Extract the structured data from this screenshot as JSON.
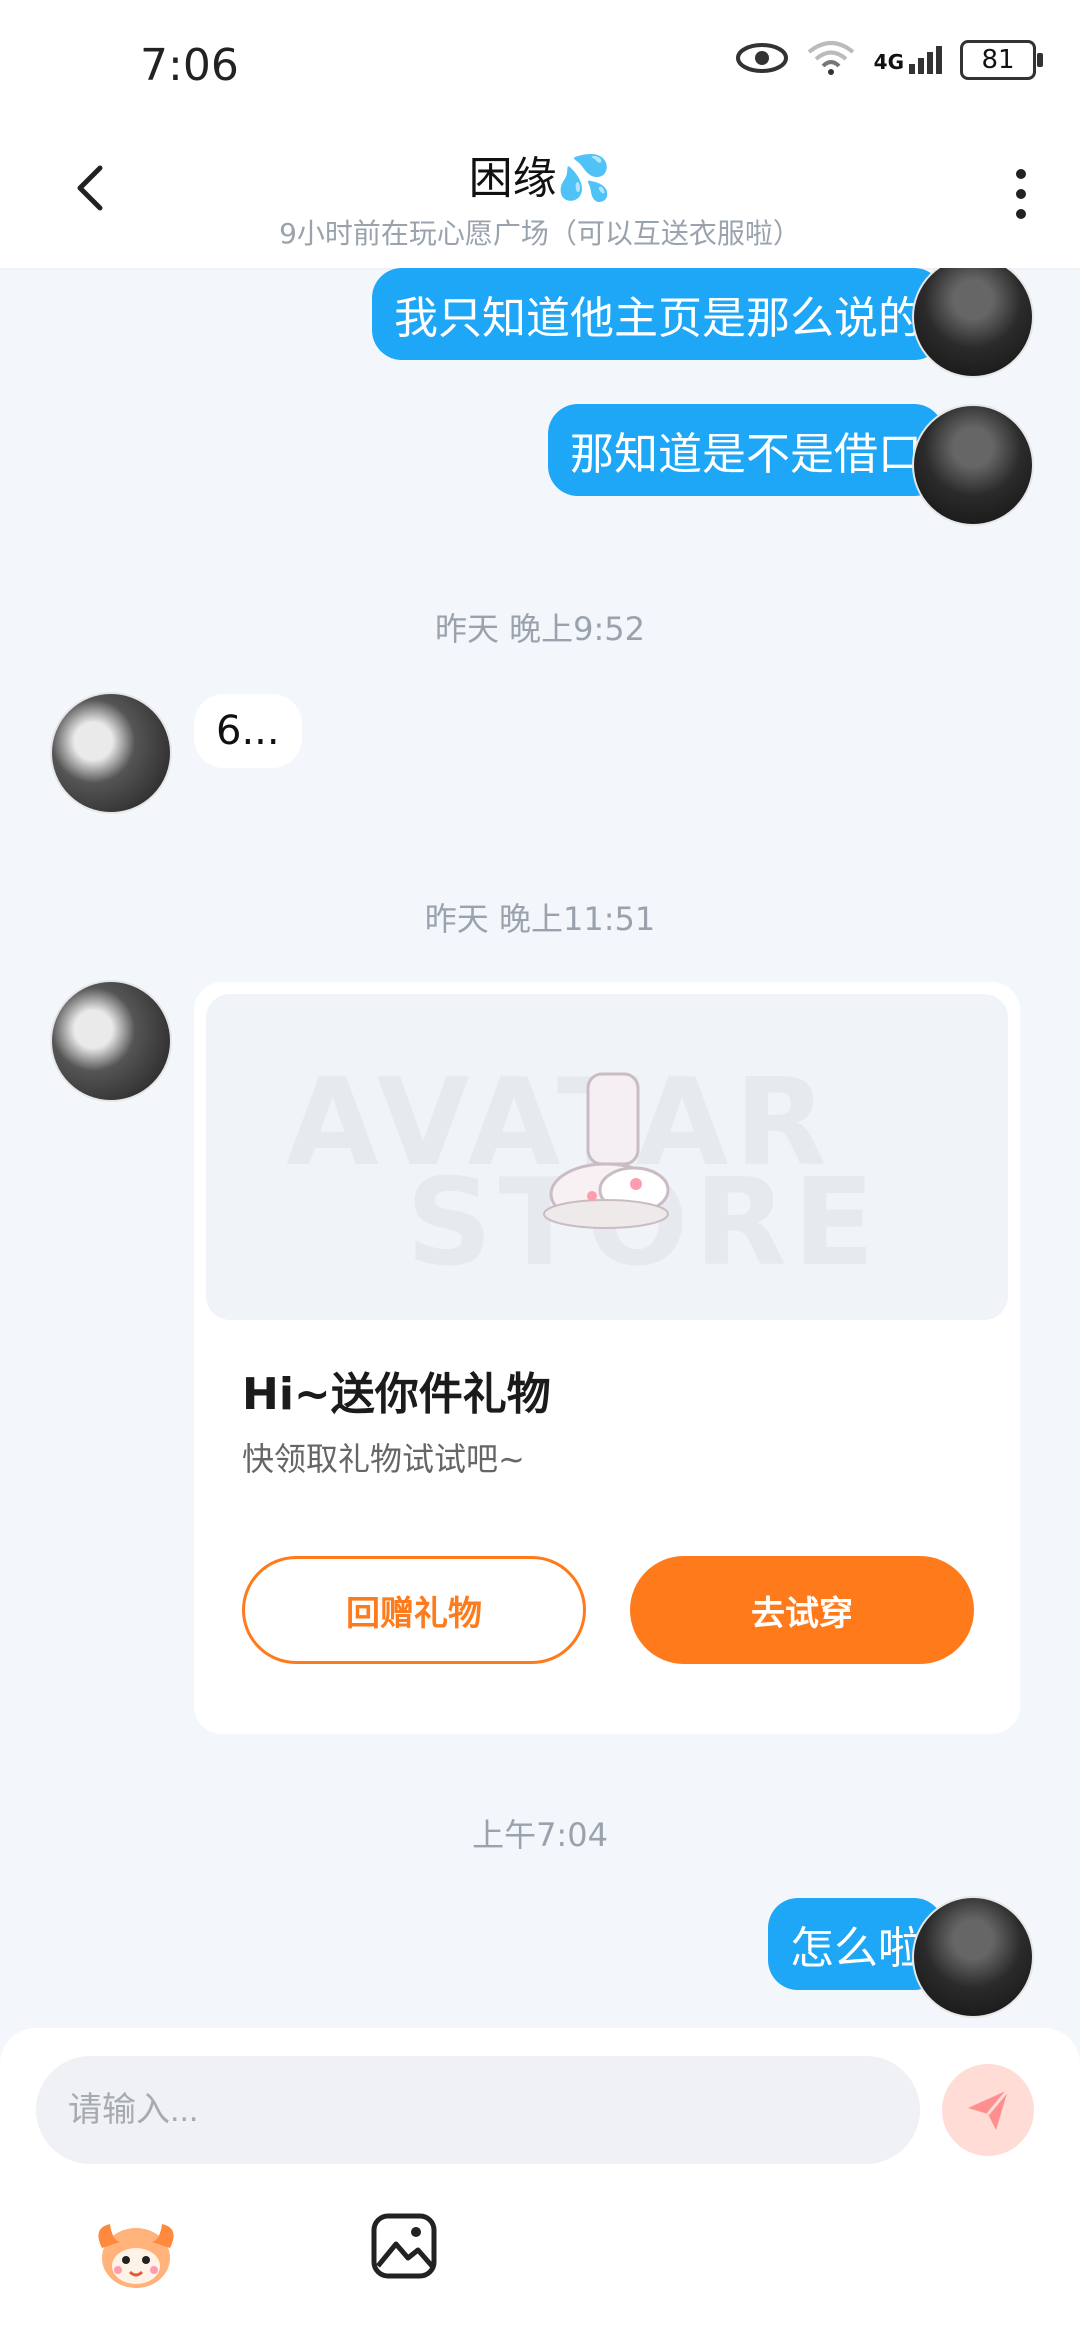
{
  "status": {
    "time": "7:06",
    "battery": "81",
    "network": "4G"
  },
  "header": {
    "title": "困缘💦",
    "subtitle": "9小时前在玩心愿广场（可以互送衣服啦）"
  },
  "messages": {
    "msg1": "我只知道他主页是那么说的",
    "msg2": "那知道是不是借口",
    "ts1": "昨天 晚上9:52",
    "msg3": "6...",
    "ts2": "昨天 晚上11:51",
    "ts3": "上午7:04",
    "msg4": "怎么啦"
  },
  "gift_card": {
    "title": "Hi~送你件礼物",
    "subtitle": "快领取礼物试试吧~",
    "btn_return": "回赠礼物",
    "btn_tryon": "去试穿",
    "watermark_top": "AVATAR",
    "watermark_bottom": "STORE"
  },
  "input": {
    "placeholder": "请输入..."
  },
  "colors": {
    "bubble_blue": "#1ea7f6",
    "accent_orange": "#ff7a1a",
    "background": "#f3f6fa"
  },
  "icons": {
    "back": "chevron-left-icon",
    "more": "more-vertical-icon",
    "send": "send-icon",
    "emoji": "mascot-emoji-icon",
    "image": "image-icon",
    "eye": "eye-icon",
    "wifi": "wifi-icon",
    "signal": "signal-icon"
  }
}
